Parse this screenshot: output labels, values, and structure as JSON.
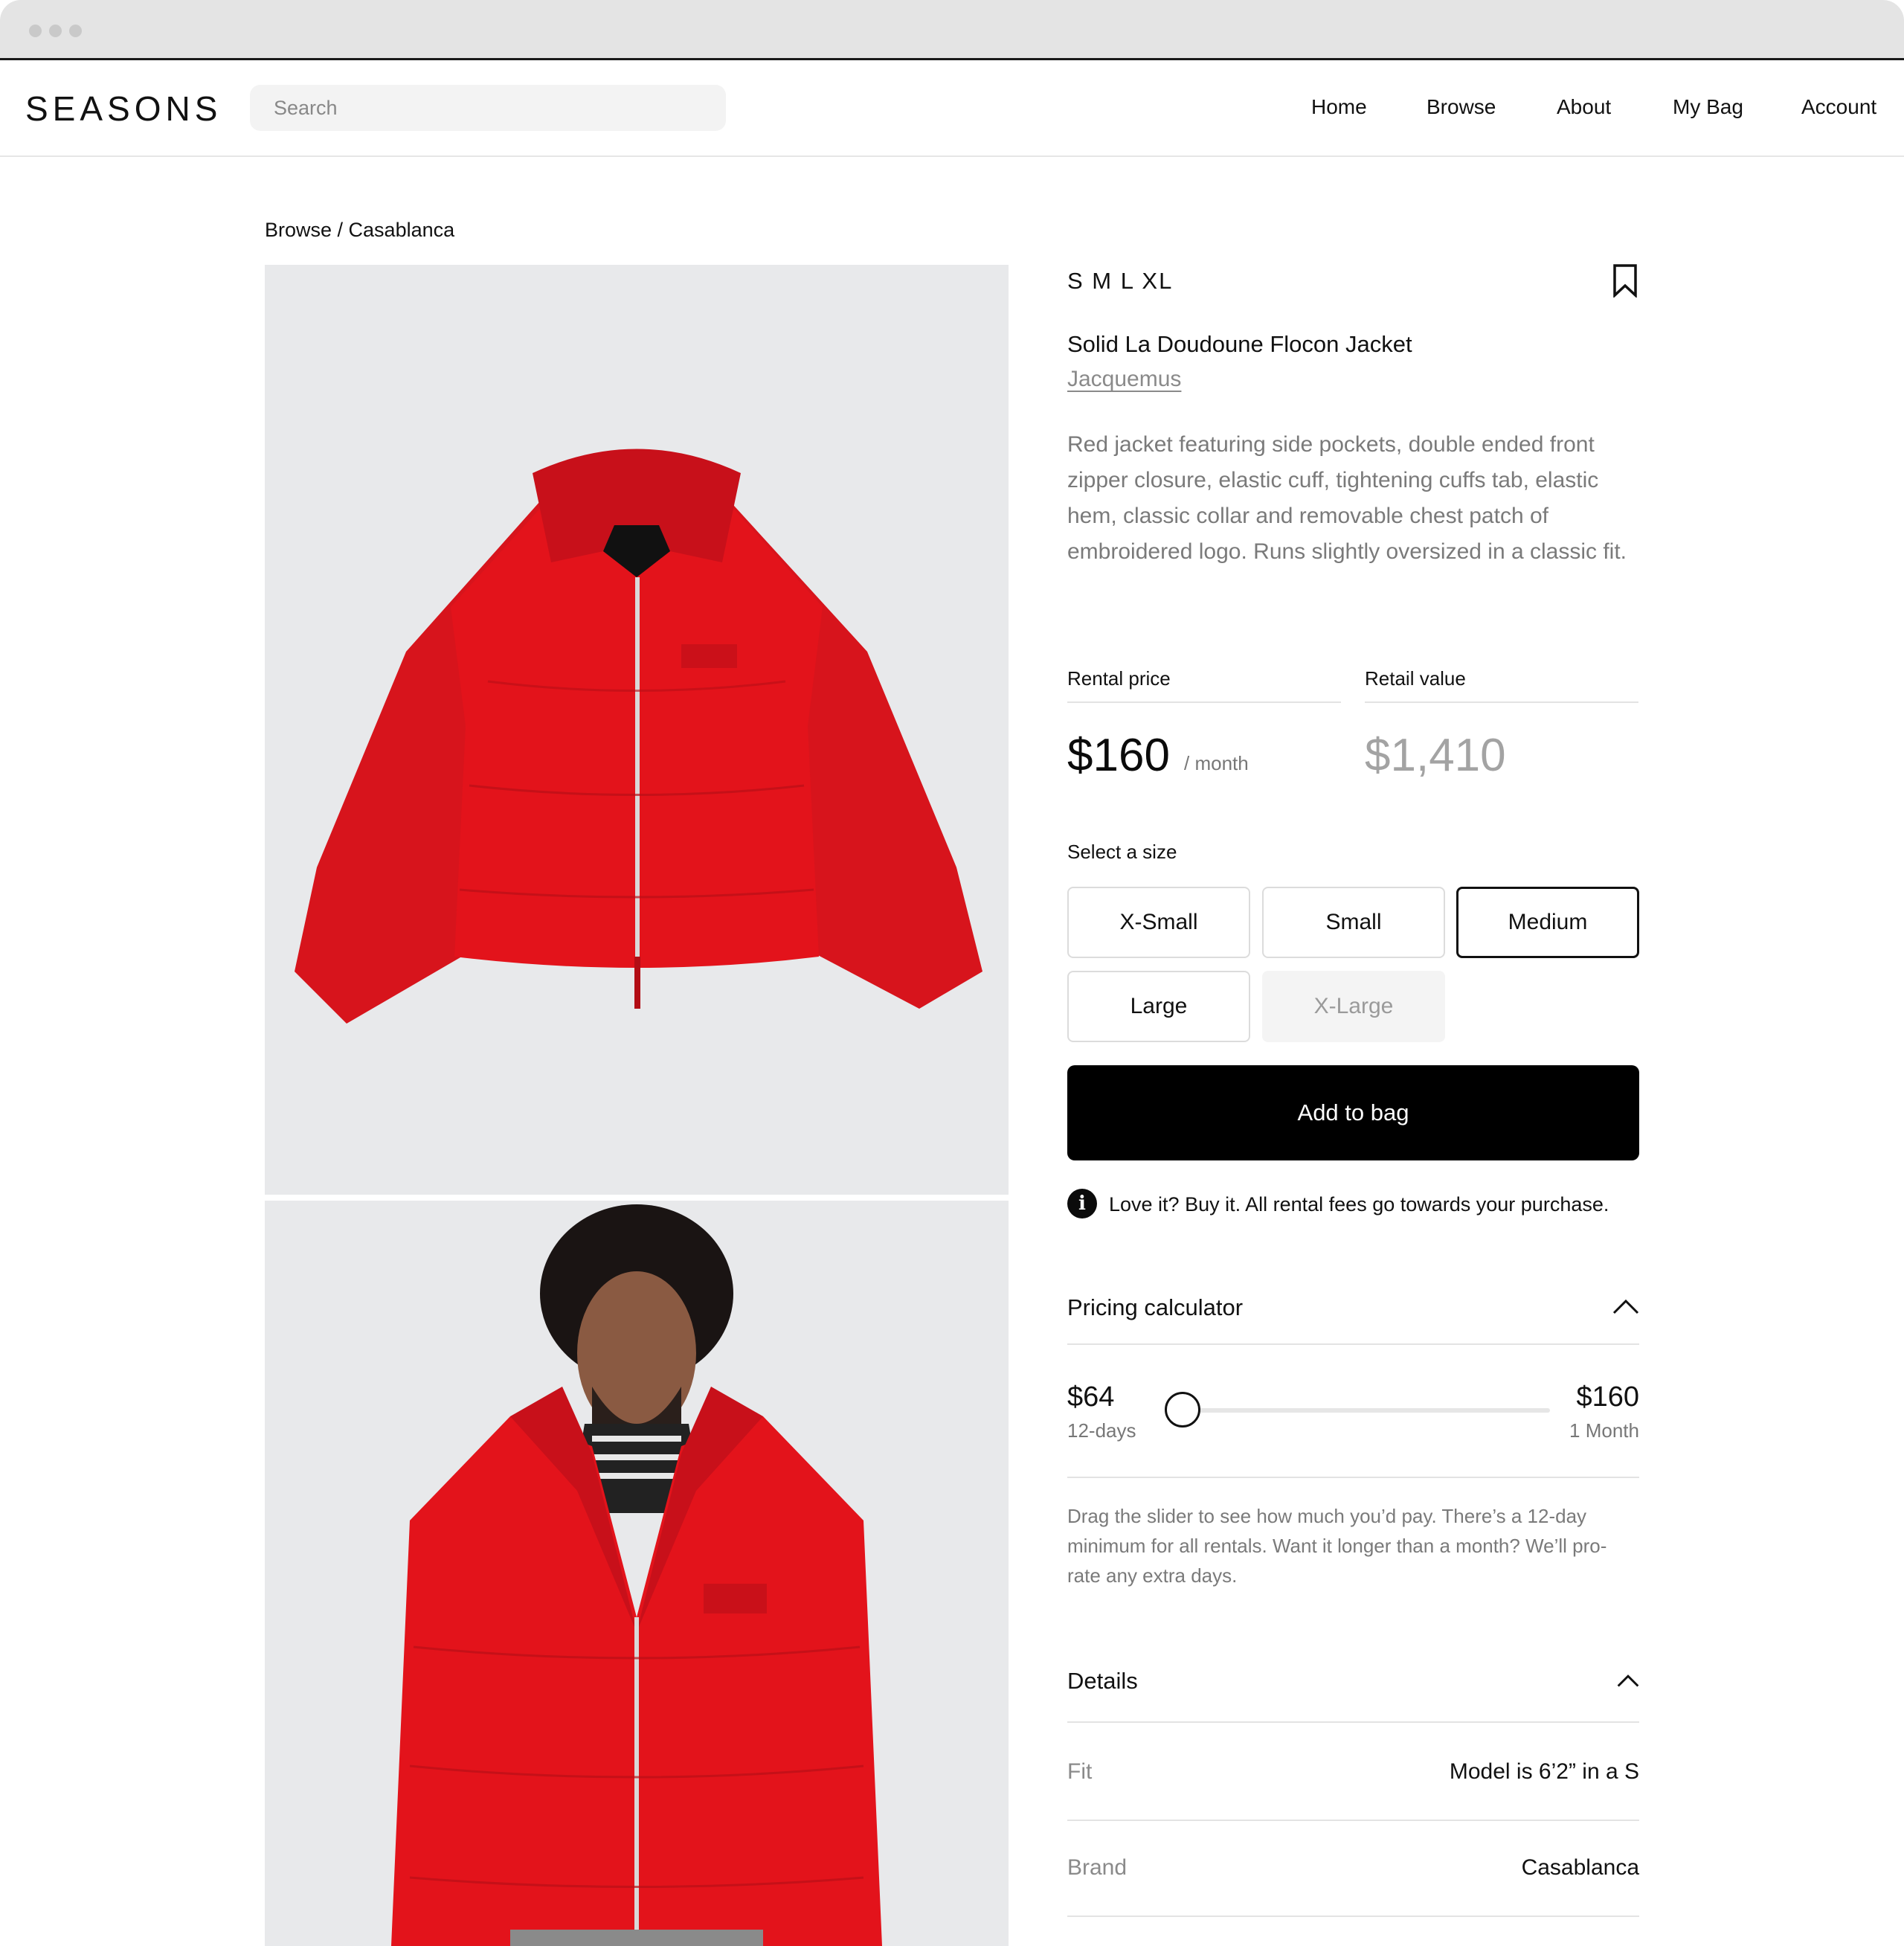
{
  "nav": {
    "logo": "SEASONS",
    "search_placeholder": "Search",
    "links": [
      "Home",
      "Browse",
      "About",
      "My Bag",
      "Account"
    ]
  },
  "breadcrumb": "Browse / Casablanca",
  "product": {
    "available_sizes": "S M L XL",
    "name": "Solid La Doudoune Flocon Jacket",
    "brand": "Jacquemus",
    "description": "Red jacket featuring side pockets, double ended front zipper closure, elastic cuff, tightening cuffs tab, elastic hem, classic collar and removable chest patch of embroidered logo. Runs slightly oversized in a classic fit.",
    "rental_label": "Rental price",
    "rental_price": "$160",
    "rental_period": "/ month",
    "retail_label": "Retail value",
    "retail_price": "$1,410"
  },
  "size_select": {
    "label": "Select a size",
    "options": [
      {
        "label": "X-Small",
        "state": "default"
      },
      {
        "label": "Small",
        "state": "default"
      },
      {
        "label": "Medium",
        "state": "selected"
      },
      {
        "label": "Large",
        "state": "default"
      },
      {
        "label": "X-Large",
        "state": "disabled"
      }
    ]
  },
  "add_to_bag": "Add to bag",
  "info_note": "Love it? Buy it. All rental fees go towards your purchase.",
  "pricing_calculator": {
    "title": "Pricing calculator",
    "min_price": "$64",
    "min_label": "12-days",
    "max_price": "$160",
    "max_label": "1 Month",
    "slider_value_fraction": 0,
    "note": "Drag the slider to see how much you’d pay. There’s a 12-day minimum for all rentals. Want it longer than a month? We’ll pro-rate any extra days."
  },
  "details": {
    "title": "Details",
    "rows": [
      {
        "label": "Fit",
        "value": "Model is 6’2” in a S"
      },
      {
        "label": "Brand",
        "value": "Casablanca"
      }
    ]
  },
  "icons": {
    "bookmark": "bookmark-icon",
    "info": "info-icon",
    "chevron": "chevron-up-icon"
  },
  "colors": {
    "accent": "#000000",
    "product_red": "#e3131b",
    "image_background": "#e8e9eb"
  }
}
